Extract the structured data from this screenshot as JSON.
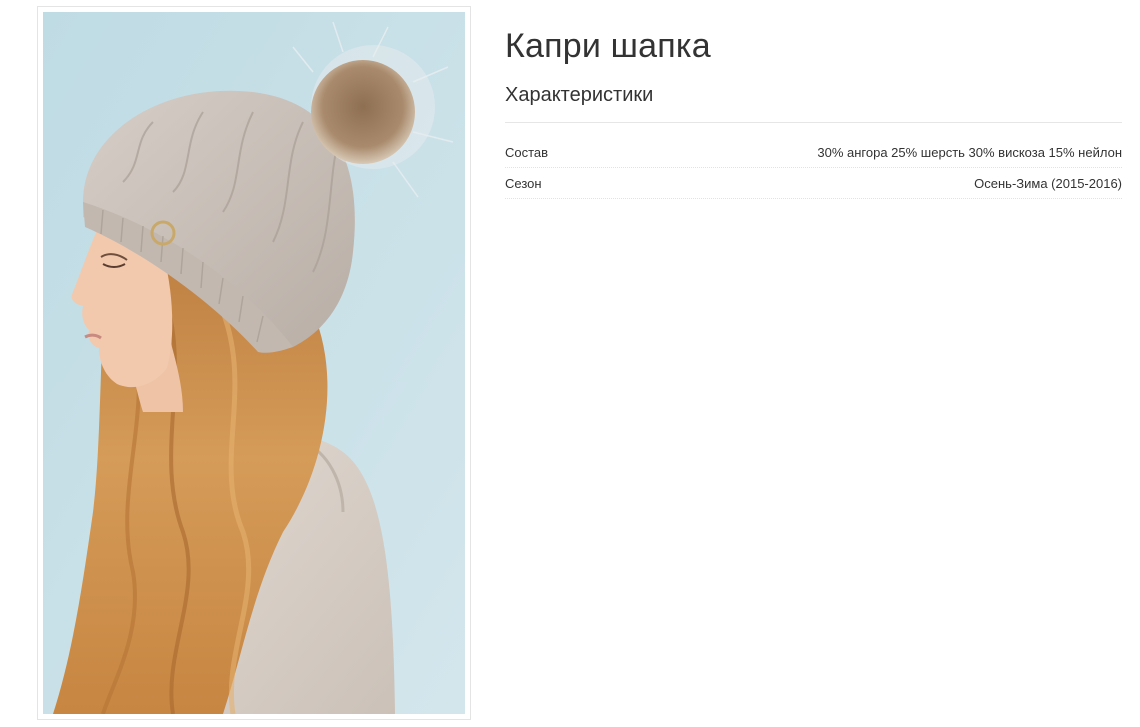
{
  "product": {
    "title": "Капри шапка",
    "image_alt": "Капри шапка"
  },
  "characteristics": {
    "heading": "Характеристики",
    "rows": [
      {
        "label": "Состав",
        "value": "30% ангора 25% шерсть 30% вискоза 15% нейлон"
      },
      {
        "label": "Сезон",
        "value": "Осень-Зима (2015-2016)"
      }
    ]
  },
  "colors": {
    "background": "#ffffff",
    "photo_backdrop": "#c7e0e7",
    "hat": "#c9c0b8",
    "pompom": "#9b7d60",
    "hair": "#c98a4a",
    "skin": "#f2c9ad",
    "sweater": "#d9d0c8"
  }
}
